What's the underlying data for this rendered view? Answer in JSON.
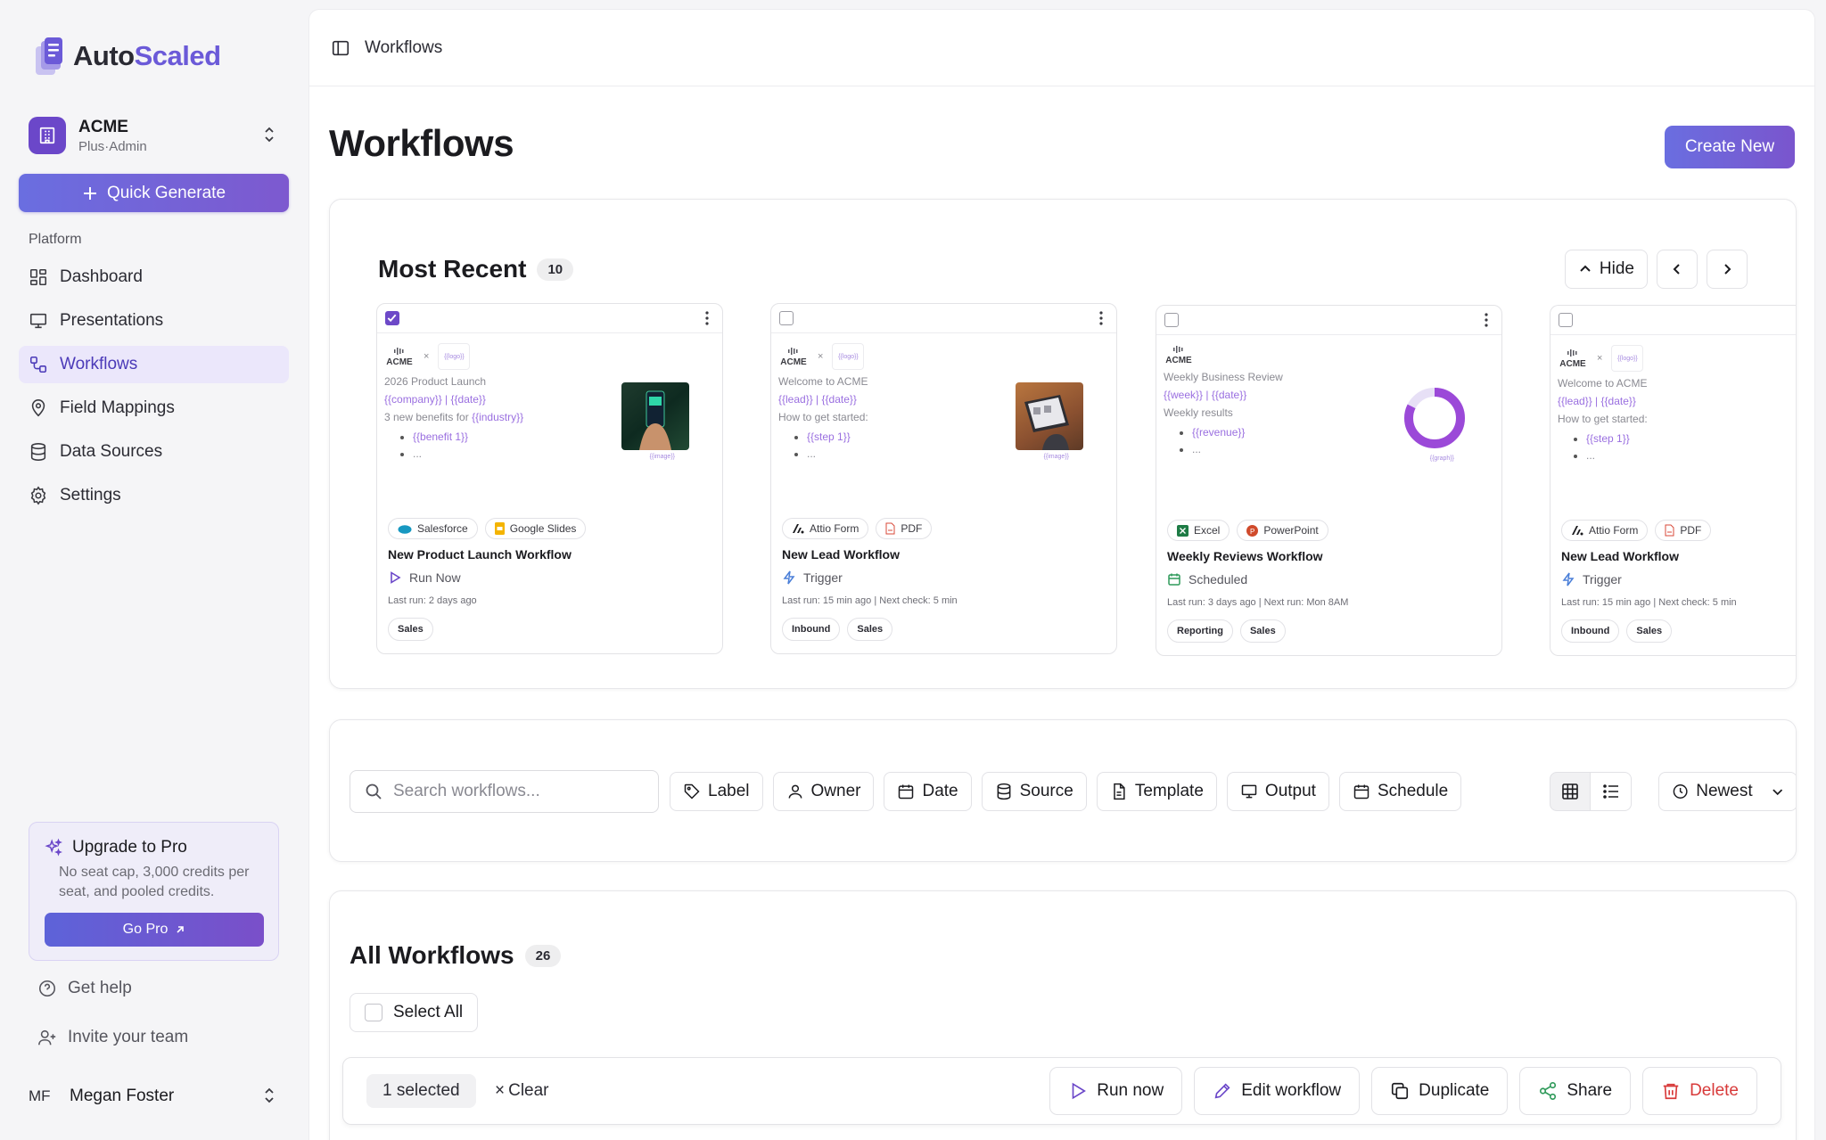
{
  "brand": {
    "name_a": "Auto",
    "name_b": "Scaled",
    "accent": "#6b5ad8"
  },
  "org": {
    "name": "ACME",
    "plan": "Plus",
    "role": "Admin"
  },
  "quick_generate": "Quick Generate",
  "nav": {
    "section": "Platform",
    "items": [
      {
        "label": "Dashboard",
        "icon": "dashboard-icon"
      },
      {
        "label": "Presentations",
        "icon": "presentation-icon"
      },
      {
        "label": "Workflows",
        "icon": "workflow-icon"
      },
      {
        "label": "Field Mappings",
        "icon": "map-pin-icon"
      },
      {
        "label": "Data Sources",
        "icon": "database-icon"
      },
      {
        "label": "Settings",
        "icon": "gear-icon"
      }
    ]
  },
  "upgrade": {
    "title": "Upgrade to Pro",
    "text": "No seat cap, 3,000 credits per seat, and pooled credits.",
    "button": "Go Pro"
  },
  "help": "Get help",
  "invite": "Invite your team",
  "user": {
    "initials": "MF",
    "name": "Megan Foster"
  },
  "topbar": {
    "title": "Workflows"
  },
  "page": {
    "title": "Workflows",
    "create": "Create New"
  },
  "recent": {
    "title": "Most Recent",
    "count": "10",
    "hide": "Hide",
    "cards": [
      {
        "checked": true,
        "doc_acme": "ACME",
        "doc_logo_ph": "{{logo}}",
        "doc_title": "2026 Product Launch",
        "doc_vars": "{{company}} | {{date}}",
        "doc_body_a": "3 new benefits for ",
        "doc_body_b": "{{industry}}",
        "doc_b1": "{{benefit 1}}",
        "doc_b2": "...",
        "img_cap": "{{image}}",
        "sources": [
          "Salesforce",
          "Google Slides"
        ],
        "name": "New Product Launch Workflow",
        "action": "Run Now",
        "meta": "Last run: 2 days ago",
        "labels": [
          "Sales"
        ]
      },
      {
        "checked": false,
        "doc_acme": "ACME",
        "doc_logo_ph": "{{logo}}",
        "doc_title": "Welcome to ACME",
        "doc_vars": "{{lead}} | {{date}}",
        "doc_body_a": "How to get started:",
        "doc_body_b": "",
        "doc_b1": "{{step 1}}",
        "doc_b2": "...",
        "img_cap": "{{image}}",
        "sources": [
          "Attio Form",
          "PDF"
        ],
        "name": "New Lead Workflow",
        "action": "Trigger",
        "meta": "Last run: 15 min ago | Next check: 5 min",
        "labels": [
          "Inbound",
          "Sales"
        ]
      },
      {
        "checked": false,
        "doc_acme": "ACME",
        "doc_logo_ph": "",
        "doc_title": "Weekly Business Review",
        "doc_vars": "{{week}} | {{date}}",
        "doc_body_a": "Weekly results",
        "doc_body_b": "",
        "doc_b1": "{{revenue}}",
        "doc_b2": "...",
        "img_cap": "{{graph}}",
        "sources": [
          "Excel",
          "PowerPoint"
        ],
        "name": "Weekly Reviews Workflow",
        "action": "Scheduled",
        "meta": "Last run: 3 days ago | Next run: Mon 8AM",
        "labels": [
          "Reporting",
          "Sales"
        ]
      },
      {
        "checked": false,
        "doc_acme": "ACME",
        "doc_logo_ph": "{{logo}}",
        "doc_title": "Welcome to ACME",
        "doc_vars": "{{lead}} | {{date}}",
        "doc_body_a": "How to get started:",
        "doc_body_b": "",
        "doc_b1": "{{step 1}}",
        "doc_b2": "...",
        "img_cap": "",
        "sources": [
          "Attio Form",
          "PDF"
        ],
        "name": "New Lead Workflow",
        "action": "Trigger",
        "meta": "Last run: 15 min ago | Next check: 5 min",
        "labels": [
          "Inbound",
          "Sales"
        ]
      }
    ]
  },
  "filters": {
    "search_placeholder": "Search workflows...",
    "chips": [
      "Label",
      "Owner",
      "Date",
      "Source",
      "Template",
      "Output",
      "Schedule"
    ],
    "sort": "Newest"
  },
  "all": {
    "title": "All Workflows",
    "count": "26",
    "select_all": "Select All",
    "selected": "1 selected",
    "clear": "Clear",
    "actions": [
      "Run now",
      "Edit workflow",
      "Duplicate",
      "Share",
      "Delete"
    ]
  }
}
